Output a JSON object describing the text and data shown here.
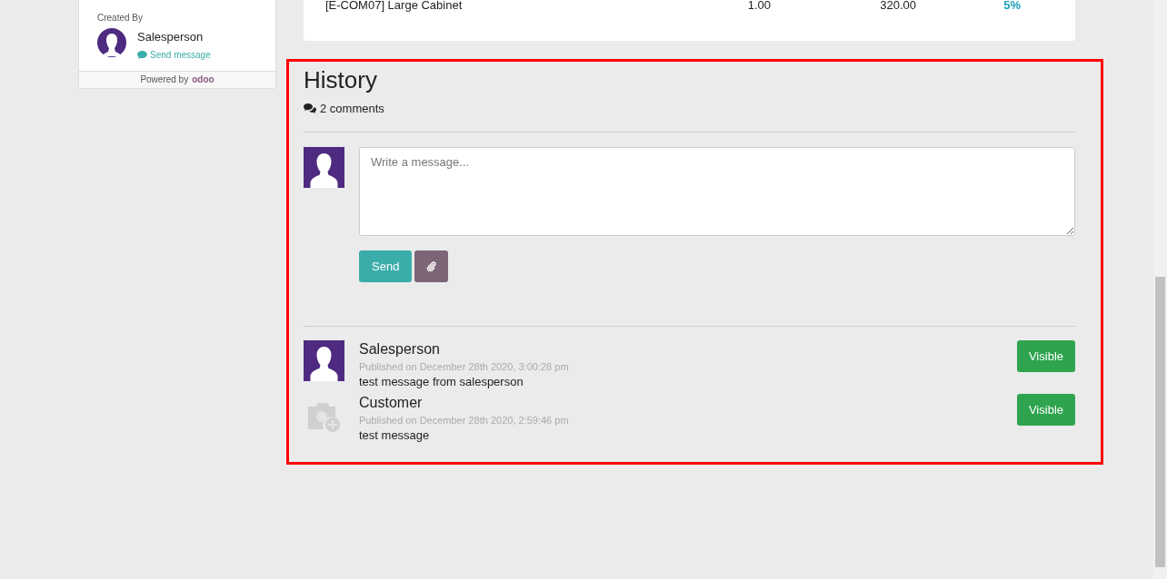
{
  "sidebar": {
    "created_by_label": "Created By",
    "author": "Salesperson",
    "send_message": "Send message",
    "powered_by": "Powered by",
    "powered_logo": "odoo"
  },
  "order_line": {
    "product": "[E-COM07] Large Cabinet",
    "quantity": "1.00",
    "price": "320.00",
    "discount": "5%"
  },
  "history": {
    "title": "History",
    "comments_count": "2 comments",
    "composer": {
      "placeholder": "Write a message..."
    },
    "send_button": "Send",
    "messages": [
      {
        "author": "Salesperson",
        "published": "Published on December 28th 2020, 3:00:28 pm",
        "body": "test message from salesperson",
        "visibility": "Visible",
        "kind": "user"
      },
      {
        "kind": "placeholder",
        "author": "Customer",
        "published": "Published on December 28th 2020, 2:59:46 pm",
        "body": "test message",
        "visibility": "Visible"
      }
    ]
  }
}
